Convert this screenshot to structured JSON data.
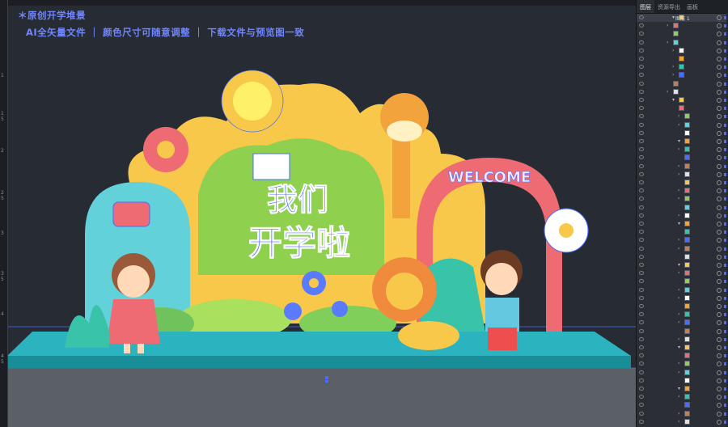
{
  "caption": {
    "line1": "＊原创开学堆景",
    "line2": "AI全矢量文件 ｜ 颜色尺寸可随意调整 ｜ 下载文件与预览图一致"
  },
  "artwork": {
    "title_top": "我们",
    "title_bottom": "开学啦",
    "arch_text": "WELCOME"
  },
  "panel": {
    "tabs": [
      "图层",
      "资源导出",
      "画板"
    ],
    "active_tab": "图层",
    "top_layer": "图层 1"
  },
  "rulers": {
    "vertical_labels": [
      "1",
      "1 5",
      "2",
      "2 5",
      "3",
      "3 5",
      "4",
      "4 5"
    ]
  },
  "colors": {
    "canvas": "#272b33",
    "selection": "#4b6cff",
    "platform": "#2bb4bf",
    "bush": "#8fd14f",
    "cloud": "#f7c84a",
    "arch": "#ef6b73"
  }
}
